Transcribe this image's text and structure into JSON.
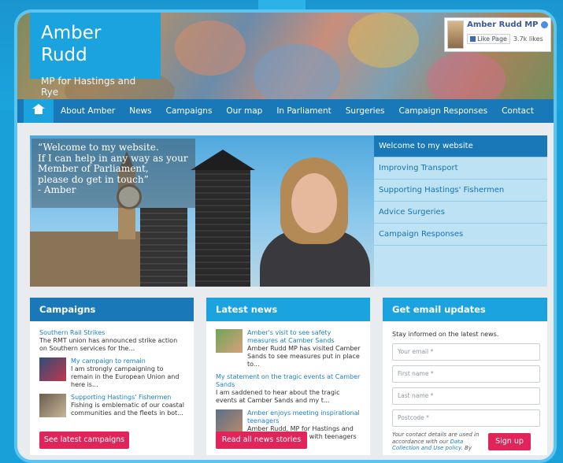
{
  "site": {
    "title": "Amber Rudd",
    "subtitle": "MP for Hastings and Rye"
  },
  "facebook": {
    "name": "Amber Rudd MP",
    "like_button": "Like Page",
    "likes": "3.7k likes"
  },
  "nav": {
    "home_icon": "home-icon",
    "items": [
      "About Amber",
      "News",
      "Campaigns",
      "Our map",
      "In Parliament",
      "Surgeries",
      "Campaign Responses",
      "Contact"
    ]
  },
  "hero": {
    "quote": "“Welcome to my website.\nIf I can help in any way as your\nMember of Parliament,\nplease do get in touch”\n- Amber"
  },
  "side_menu": {
    "items": [
      "Welcome to my website",
      "Improving Transport",
      "Supporting Hastings' Fishermen",
      "Advice Surgeries",
      "Campaign Responses"
    ],
    "active_index": 0
  },
  "campaigns": {
    "heading": "Campaigns",
    "items": [
      {
        "title": "Southern Rail Strikes",
        "text": "The RMT union has announced strike action on Southern services for the..."
      },
      {
        "title": "My campaign to remain",
        "text": "I am strongly campaigning to remain in the European Union and here is..."
      },
      {
        "title": "Supporting Hastings' Fishermen",
        "text": "Fishing is emblematic of our coastal communities and the fleets in bot..."
      }
    ],
    "button": "See latest campaigns"
  },
  "news": {
    "heading": "Latest news",
    "items": [
      {
        "title": "Amber's visit to see safety measures at Camber Sands",
        "text": "Amber Rudd MP has visited Camber Sands to see measures put in place to..."
      },
      {
        "title": "My statement on the tragic events at Camber Sands",
        "text": "I am saddened to hear about the tragic events at Camber Sands and my t..."
      },
      {
        "title": "Amber enjoys meeting inspirational teenagers",
        "text": "Amber Rudd, MP for Hastings and Rye, last week met with teenagers at t..."
      }
    ],
    "button": "Read all news stories"
  },
  "email": {
    "heading": "Get email updates",
    "intro": "Stay informed on the latest news.",
    "placeholders": [
      "Your email *",
      "First name *",
      "Last name *",
      "Postcode *"
    ],
    "disclaimer_pre": "Your contact details are used in accordance with our ",
    "disclaimer_link": "Data Collection and Use policy",
    "disclaimer_post": ". By",
    "button": "Sign up"
  },
  "colors": {
    "primary_dark": "#1878b8",
    "primary_light": "#1aa3de",
    "accent": "#e1245a"
  }
}
